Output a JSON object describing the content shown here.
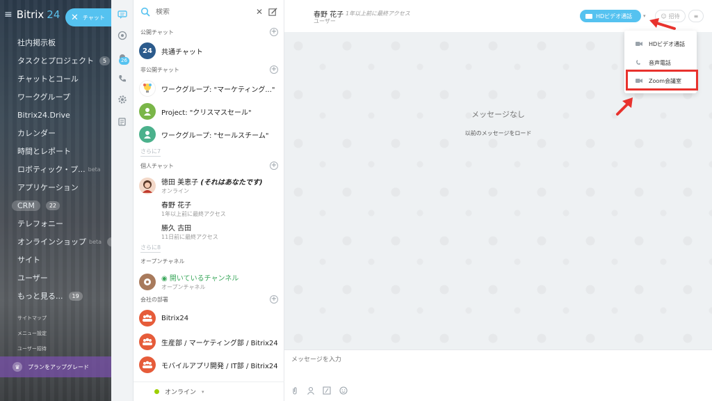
{
  "sidebar": {
    "brand": "Bitrix",
    "brand_num": "24",
    "chat_button": "チャット",
    "items": [
      {
        "label": "社内掲示板",
        "count": ""
      },
      {
        "label": "タスクとプロジェクト",
        "count": "5"
      },
      {
        "label": "チャットとコール",
        "count": ""
      },
      {
        "label": "ワークグループ",
        "count": ""
      },
      {
        "label": "Bitrix24.Drive",
        "count": ""
      },
      {
        "label": "カレンダー",
        "count": ""
      },
      {
        "label": "時間とレポート",
        "count": ""
      },
      {
        "label": "ロボティック・プ...",
        "count": "",
        "beta": "beta"
      },
      {
        "label": "アプリケーション",
        "count": ""
      },
      {
        "label": "CRM",
        "count": "22"
      },
      {
        "label": "テレフォニー",
        "count": ""
      },
      {
        "label": "オンラインショップ",
        "count": "1",
        "beta": "beta"
      },
      {
        "label": "サイト",
        "count": ""
      },
      {
        "label": "ユーザー",
        "count": ""
      },
      {
        "label": "もっと見る...",
        "count": "19"
      }
    ],
    "sub_items": [
      "サイトマップ",
      "メニュー設定",
      "ユーザー招待"
    ],
    "upgrade": "プランをアップグレード"
  },
  "icon_column": {
    "badge": "26"
  },
  "chat_list": {
    "search_placeholder": "検索",
    "sections": {
      "public": "公開チャット",
      "private": "非公開チャット",
      "personal": "個人チャット",
      "open": "オープンチャネル",
      "departments": "会社の部署"
    },
    "public_chats": [
      {
        "name": "共通チャット",
        "avatar": "24"
      }
    ],
    "private_chats": [
      {
        "name": "ワークグループ: \"マーケティング...\""
      },
      {
        "name": "Project: \"クリスマスセール\""
      },
      {
        "name": "ワークグループ: \"セールスチーム\""
      }
    ],
    "more_private": "さらに7",
    "personal_chats": [
      {
        "name": "徳田 美恵子",
        "self": "(それはあなたです)",
        "sub": "オンライン"
      },
      {
        "name": "春野 花子",
        "sub": "1年以上前に最終アクセス"
      },
      {
        "name": "勝久 古田",
        "sub": "11日前に最終アクセス"
      }
    ],
    "more_personal": "さらに8",
    "open_channel": {
      "name": "開いているチャンネル",
      "sub": "オープンチャネル"
    },
    "departments": [
      {
        "name": "Bitrix24"
      },
      {
        "name": "生産部 / マーケティング部 / Bitrix24"
      },
      {
        "name": "モバイルアプリ開発 / IT部 / Bitrix24"
      }
    ],
    "status": "オンライン"
  },
  "header": {
    "name": "春野 花子",
    "last_seen": "1年以上前に最終アクセス",
    "role": "ユーザー",
    "hd_button": "HDビデオ通話",
    "invite_button": "招待"
  },
  "messages": {
    "empty": "メッセージなし",
    "load": "以前のメッセージをロード"
  },
  "composer": {
    "placeholder": "メッセージを入力"
  },
  "dropdown": {
    "items": [
      "HDビデオ通話",
      "音声電話",
      "Zoom会議室"
    ]
  },
  "colors": {
    "accent": "#55c2f0",
    "highlight": "#e8322d",
    "online": "#9dcf00"
  }
}
